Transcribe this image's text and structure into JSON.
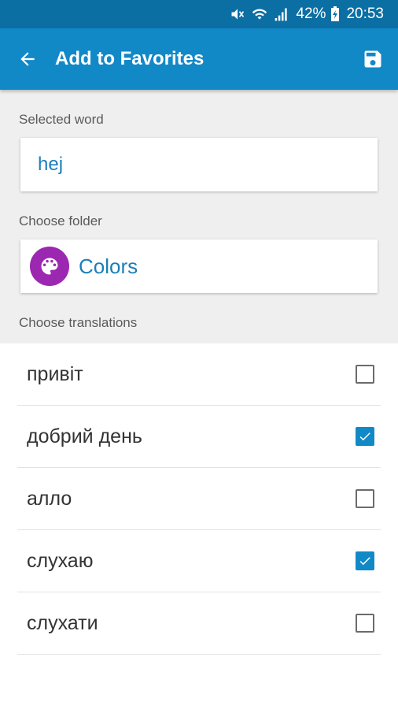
{
  "status_bar": {
    "battery_percent": "42%",
    "time": "20:53",
    "icons": [
      "mute-icon",
      "wifi-icon",
      "signal-icon",
      "battery-charging-icon"
    ]
  },
  "app_bar": {
    "title": "Add to Favorites",
    "back_icon": "arrow-back-icon",
    "save_icon": "save-icon"
  },
  "selected_word": {
    "label": "Selected word",
    "value": "hej"
  },
  "folder": {
    "label": "Choose folder",
    "name": "Colors",
    "icon": "palette-icon",
    "color": "#9c27b0"
  },
  "translations": {
    "label": "Choose translations",
    "items": [
      {
        "text": "привіт",
        "checked": false
      },
      {
        "text": "добрий день",
        "checked": true
      },
      {
        "text": "алло",
        "checked": false
      },
      {
        "text": "слухаю",
        "checked": true
      },
      {
        "text": "слухати",
        "checked": false
      }
    ]
  },
  "colors": {
    "status_bar": "#0b6fa4",
    "app_bar": "#1289c7",
    "accent": "#1a7fba"
  }
}
